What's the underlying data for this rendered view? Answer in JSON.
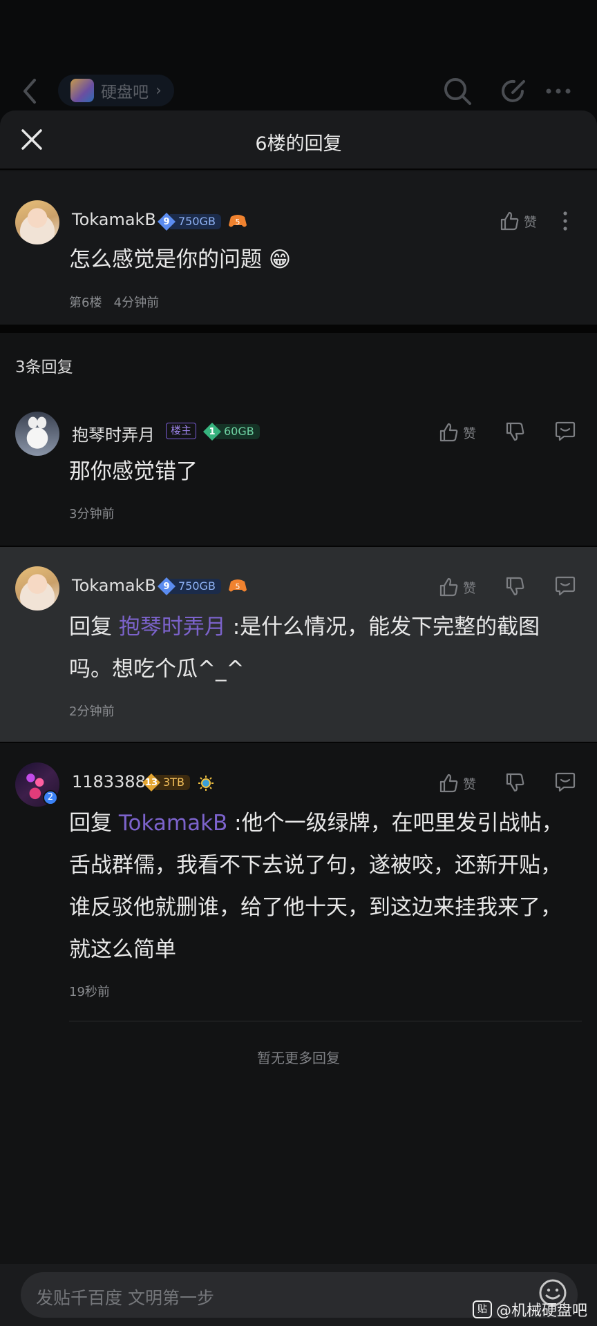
{
  "nav": {
    "forum_name": "硬盘吧",
    "forum_chevron": "›"
  },
  "sheet": {
    "title": "6楼的回复"
  },
  "main_comment": {
    "user": "TokamakB",
    "level": "9",
    "level_tag": "750GB",
    "text": "怎么感觉是你的问题 😁",
    "floor": "第6楼",
    "time": "4分钟前",
    "like_label": "赞"
  },
  "reply_count": "3条回复",
  "replies": [
    {
      "user": "抱琴时弄月",
      "host_tag": "楼主",
      "level": "1",
      "level_tag": "60GB",
      "text": "那你感觉错了",
      "time": "3分钟前",
      "like_label": "赞"
    },
    {
      "user": "TokamakB",
      "level": "9",
      "level_tag": "750GB",
      "reply_prefix": "回复 ",
      "mention": "抱琴时弄月",
      "text": " :是什么情况，能发下完整的截图吗。想吃个瓜^_^",
      "time": "2分钟前",
      "like_label": "赞"
    },
    {
      "user": "1183388",
      "avatar_badge": "2",
      "level": "13",
      "level_tag": "3TB",
      "reply_prefix": "回复 ",
      "mention": "TokamakB",
      "text": " :他个一级绿牌，在吧里发引战帖，舌战群儒，我看不下去说了句，遂被咬，还新开贴，谁反驳他就删谁，给了他十天，到这边来挂我来了，就这么简单",
      "time": "19秒前",
      "like_label": "赞"
    }
  ],
  "no_more": "暂无更多回复",
  "input": {
    "placeholder": "发贴千百度 文明第一步"
  },
  "watermark": {
    "logo": "贴",
    "text": "@机械硬盘吧"
  },
  "colors": {
    "mention": "#7c63cc",
    "level_blue": "#5b8cf0",
    "level_green": "#37b37e",
    "level_gold": "#e3a531"
  }
}
